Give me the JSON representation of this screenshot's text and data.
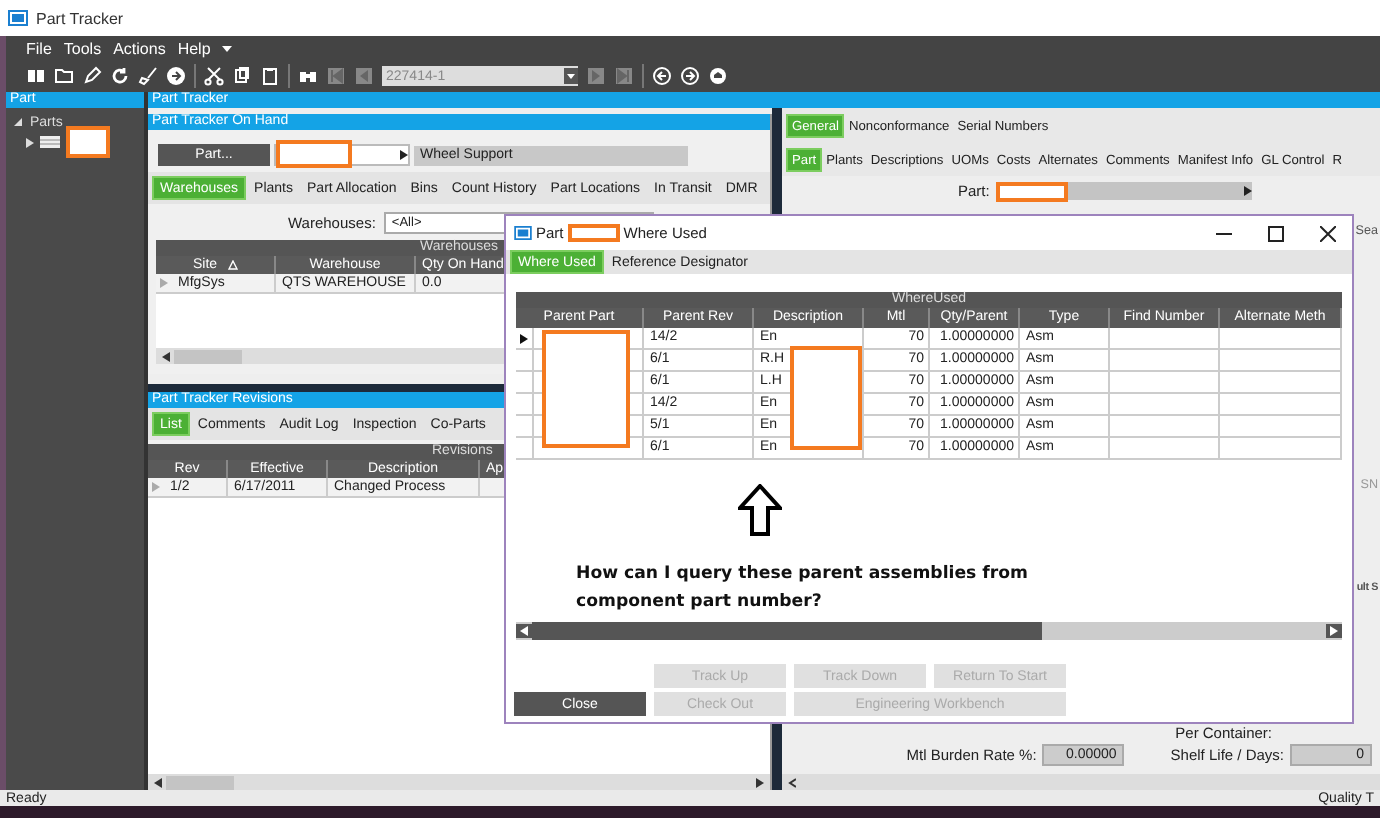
{
  "window": {
    "title": "Part Tracker"
  },
  "menu": [
    "File",
    "Tools",
    "Actions",
    "Help"
  ],
  "toolbar": {
    "record_field": "227414-1"
  },
  "tree_panel": {
    "title": "Part",
    "root": {
      "label": "Parts",
      "expanded": true,
      "children": [
        {
          "redacted": true
        }
      ]
    }
  },
  "main": {
    "title": "Part Tracker"
  },
  "on_hand": {
    "title": "Part Tracker On Hand",
    "part_button": "Part...",
    "part_redacted": true,
    "part_description": "Wheel Support",
    "tabs": [
      {
        "label": "Warehouses",
        "selected": true
      },
      {
        "label": "Plants",
        "selected": false
      },
      {
        "label": "Part Allocation",
        "selected": false
      },
      {
        "label": "Bins",
        "selected": false
      },
      {
        "label": "Count History",
        "selected": false
      },
      {
        "label": "Part Locations",
        "selected": false
      },
      {
        "label": "In Transit",
        "selected": false
      },
      {
        "label": "DMR",
        "selected": false
      }
    ],
    "filter_label": "Warehouses:",
    "filter_value": "<All>",
    "grid": {
      "title": "Warehouses",
      "columns": [
        {
          "label": "Site",
          "sorted": true
        },
        {
          "label": "Warehouse",
          "sorted": false
        },
        {
          "label": "Qty On Hand",
          "sorted": false
        }
      ],
      "rows": [
        {
          "selected": false,
          "cells": [
            "MfgSys",
            "QTS WAREHOUSE",
            "0.0"
          ]
        }
      ]
    }
  },
  "revisions": {
    "title": "Part Tracker Revisions",
    "tabs": [
      {
        "label": "List",
        "selected": true
      },
      {
        "label": "Comments",
        "selected": false
      },
      {
        "label": "Audit Log",
        "selected": false
      },
      {
        "label": "Inspection",
        "selected": false
      },
      {
        "label": "Co-Parts",
        "selected": false
      }
    ],
    "grid": {
      "title": "Revisions",
      "columns": [
        "Rev",
        "Effective",
        "Description",
        "Ap"
      ],
      "rows": [
        {
          "selected": false,
          "cells": [
            "1/2",
            "6/17/2011",
            "Changed Process"
          ]
        }
      ]
    }
  },
  "detail": {
    "tab_rows": [
      [
        {
          "label": "General",
          "selected": true
        },
        {
          "label": "Nonconformance",
          "selected": false
        },
        {
          "label": "Serial Numbers",
          "selected": false
        }
      ],
      [
        {
          "label": "Part",
          "selected": true
        },
        {
          "label": "Plants",
          "selected": false
        },
        {
          "label": "Descriptions",
          "selected": false
        },
        {
          "label": "UOMs",
          "selected": false
        },
        {
          "label": "Costs",
          "selected": false
        },
        {
          "label": "Alternates",
          "selected": false
        },
        {
          "label": "Comments",
          "selected": false
        },
        {
          "label": "Manifest Info",
          "selected": false
        },
        {
          "label": "GL Control",
          "selected": false
        },
        {
          "label": "R",
          "selected": false
        }
      ]
    ],
    "part_label": "Part:",
    "part_redacted": true,
    "side_texts": [
      "Sea",
      "SN",
      "ult S"
    ],
    "per_container_label": "Per Container:",
    "fields": [
      {
        "label": "Mtl Burden Rate %:",
        "value": "0.00000"
      },
      {
        "label": "Shelf Life / Days:",
        "value": "0"
      }
    ]
  },
  "dialog": {
    "title_prefix": "Part",
    "title_redacted": true,
    "title_suffix": "Where Used",
    "tabs": [
      {
        "label": "Where Used",
        "selected": true
      },
      {
        "label": "Reference Designator",
        "selected": false
      }
    ],
    "grid": {
      "title": "WhereUsed",
      "columns": [
        "Parent Part",
        "Parent Rev",
        "Description",
        "Mtl",
        "Qty/Parent",
        "Type",
        "Find Number",
        "Alternate Meth"
      ],
      "rows": [
        {
          "selected": true,
          "rev": "14/2",
          "description": "En",
          "mtl": "70",
          "qty": "1.00000000",
          "type": "Asm"
        },
        {
          "selected": false,
          "rev": "6/1",
          "description": "R.H",
          "mtl": "70",
          "qty": "1.00000000",
          "type": "Asm"
        },
        {
          "selected": false,
          "rev": "6/1",
          "description": "L.H",
          "mtl": "70",
          "qty": "1.00000000",
          "type": "Asm"
        },
        {
          "selected": false,
          "rev": "14/2",
          "description": "En",
          "mtl": "70",
          "qty": "1.00000000",
          "type": "Asm"
        },
        {
          "selected": false,
          "rev": "5/1",
          "description": "En",
          "mtl": "70",
          "qty": "1.00000000",
          "type": "Asm"
        },
        {
          "selected": false,
          "rev": "6/1",
          "description": "En",
          "mtl": "70",
          "qty": "1.00000000",
          "type": "Asm"
        }
      ],
      "parent_part_redacted": true,
      "description_redacted": true
    },
    "annotation": "How can I query these parent assemblies from component part number?",
    "close_button": {
      "label": "Close",
      "disabled": false
    },
    "button_rows": [
      [
        {
          "label": "Track Up",
          "disabled": true,
          "kind": "normal"
        },
        {
          "label": "Track Down",
          "disabled": true,
          "kind": "normal"
        },
        {
          "label": "Return To Start",
          "disabled": true,
          "kind": "normal"
        }
      ],
      [
        {
          "label": "Check Out",
          "disabled": true,
          "kind": "normal"
        },
        {
          "label": "Engineering Workbench",
          "disabled": true,
          "kind": "wide"
        }
      ]
    ]
  },
  "status_bar": {
    "left": "Ready",
    "right": "Quality T"
  }
}
